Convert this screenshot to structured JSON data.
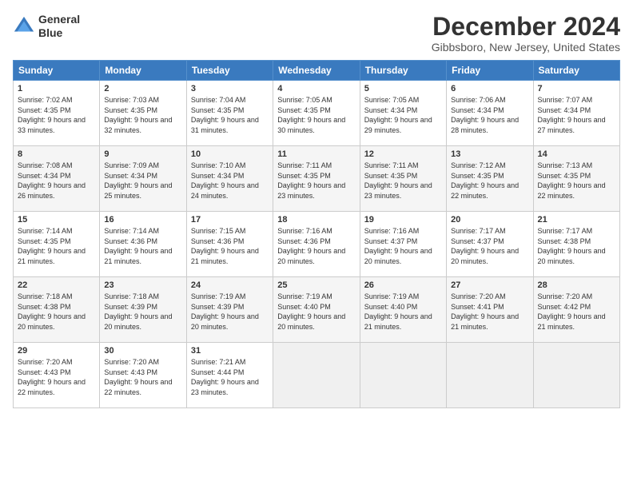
{
  "header": {
    "logo_line1": "General",
    "logo_line2": "Blue",
    "title": "December 2024",
    "location": "Gibbsboro, New Jersey, United States"
  },
  "days_header": [
    "Sunday",
    "Monday",
    "Tuesday",
    "Wednesday",
    "Thursday",
    "Friday",
    "Saturday"
  ],
  "weeks": [
    [
      {
        "day": "1",
        "sunrise": "Sunrise: 7:02 AM",
        "sunset": "Sunset: 4:35 PM",
        "daylight": "Daylight: 9 hours and 33 minutes."
      },
      {
        "day": "2",
        "sunrise": "Sunrise: 7:03 AM",
        "sunset": "Sunset: 4:35 PM",
        "daylight": "Daylight: 9 hours and 32 minutes."
      },
      {
        "day": "3",
        "sunrise": "Sunrise: 7:04 AM",
        "sunset": "Sunset: 4:35 PM",
        "daylight": "Daylight: 9 hours and 31 minutes."
      },
      {
        "day": "4",
        "sunrise": "Sunrise: 7:05 AM",
        "sunset": "Sunset: 4:35 PM",
        "daylight": "Daylight: 9 hours and 30 minutes."
      },
      {
        "day": "5",
        "sunrise": "Sunrise: 7:05 AM",
        "sunset": "Sunset: 4:34 PM",
        "daylight": "Daylight: 9 hours and 29 minutes."
      },
      {
        "day": "6",
        "sunrise": "Sunrise: 7:06 AM",
        "sunset": "Sunset: 4:34 PM",
        "daylight": "Daylight: 9 hours and 28 minutes."
      },
      {
        "day": "7",
        "sunrise": "Sunrise: 7:07 AM",
        "sunset": "Sunset: 4:34 PM",
        "daylight": "Daylight: 9 hours and 27 minutes."
      }
    ],
    [
      {
        "day": "8",
        "sunrise": "Sunrise: 7:08 AM",
        "sunset": "Sunset: 4:34 PM",
        "daylight": "Daylight: 9 hours and 26 minutes."
      },
      {
        "day": "9",
        "sunrise": "Sunrise: 7:09 AM",
        "sunset": "Sunset: 4:34 PM",
        "daylight": "Daylight: 9 hours and 25 minutes."
      },
      {
        "day": "10",
        "sunrise": "Sunrise: 7:10 AM",
        "sunset": "Sunset: 4:34 PM",
        "daylight": "Daylight: 9 hours and 24 minutes."
      },
      {
        "day": "11",
        "sunrise": "Sunrise: 7:11 AM",
        "sunset": "Sunset: 4:35 PM",
        "daylight": "Daylight: 9 hours and 23 minutes."
      },
      {
        "day": "12",
        "sunrise": "Sunrise: 7:11 AM",
        "sunset": "Sunset: 4:35 PM",
        "daylight": "Daylight: 9 hours and 23 minutes."
      },
      {
        "day": "13",
        "sunrise": "Sunrise: 7:12 AM",
        "sunset": "Sunset: 4:35 PM",
        "daylight": "Daylight: 9 hours and 22 minutes."
      },
      {
        "day": "14",
        "sunrise": "Sunrise: 7:13 AM",
        "sunset": "Sunset: 4:35 PM",
        "daylight": "Daylight: 9 hours and 22 minutes."
      }
    ],
    [
      {
        "day": "15",
        "sunrise": "Sunrise: 7:14 AM",
        "sunset": "Sunset: 4:35 PM",
        "daylight": "Daylight: 9 hours and 21 minutes."
      },
      {
        "day": "16",
        "sunrise": "Sunrise: 7:14 AM",
        "sunset": "Sunset: 4:36 PM",
        "daylight": "Daylight: 9 hours and 21 minutes."
      },
      {
        "day": "17",
        "sunrise": "Sunrise: 7:15 AM",
        "sunset": "Sunset: 4:36 PM",
        "daylight": "Daylight: 9 hours and 21 minutes."
      },
      {
        "day": "18",
        "sunrise": "Sunrise: 7:16 AM",
        "sunset": "Sunset: 4:36 PM",
        "daylight": "Daylight: 9 hours and 20 minutes."
      },
      {
        "day": "19",
        "sunrise": "Sunrise: 7:16 AM",
        "sunset": "Sunset: 4:37 PM",
        "daylight": "Daylight: 9 hours and 20 minutes."
      },
      {
        "day": "20",
        "sunrise": "Sunrise: 7:17 AM",
        "sunset": "Sunset: 4:37 PM",
        "daylight": "Daylight: 9 hours and 20 minutes."
      },
      {
        "day": "21",
        "sunrise": "Sunrise: 7:17 AM",
        "sunset": "Sunset: 4:38 PM",
        "daylight": "Daylight: 9 hours and 20 minutes."
      }
    ],
    [
      {
        "day": "22",
        "sunrise": "Sunrise: 7:18 AM",
        "sunset": "Sunset: 4:38 PM",
        "daylight": "Daylight: 9 hours and 20 minutes."
      },
      {
        "day": "23",
        "sunrise": "Sunrise: 7:18 AM",
        "sunset": "Sunset: 4:39 PM",
        "daylight": "Daylight: 9 hours and 20 minutes."
      },
      {
        "day": "24",
        "sunrise": "Sunrise: 7:19 AM",
        "sunset": "Sunset: 4:39 PM",
        "daylight": "Daylight: 9 hours and 20 minutes."
      },
      {
        "day": "25",
        "sunrise": "Sunrise: 7:19 AM",
        "sunset": "Sunset: 4:40 PM",
        "daylight": "Daylight: 9 hours and 20 minutes."
      },
      {
        "day": "26",
        "sunrise": "Sunrise: 7:19 AM",
        "sunset": "Sunset: 4:40 PM",
        "daylight": "Daylight: 9 hours and 21 minutes."
      },
      {
        "day": "27",
        "sunrise": "Sunrise: 7:20 AM",
        "sunset": "Sunset: 4:41 PM",
        "daylight": "Daylight: 9 hours and 21 minutes."
      },
      {
        "day": "28",
        "sunrise": "Sunrise: 7:20 AM",
        "sunset": "Sunset: 4:42 PM",
        "daylight": "Daylight: 9 hours and 21 minutes."
      }
    ],
    [
      {
        "day": "29",
        "sunrise": "Sunrise: 7:20 AM",
        "sunset": "Sunset: 4:43 PM",
        "daylight": "Daylight: 9 hours and 22 minutes."
      },
      {
        "day": "30",
        "sunrise": "Sunrise: 7:20 AM",
        "sunset": "Sunset: 4:43 PM",
        "daylight": "Daylight: 9 hours and 22 minutes."
      },
      {
        "day": "31",
        "sunrise": "Sunrise: 7:21 AM",
        "sunset": "Sunset: 4:44 PM",
        "daylight": "Daylight: 9 hours and 23 minutes."
      },
      null,
      null,
      null,
      null
    ]
  ]
}
